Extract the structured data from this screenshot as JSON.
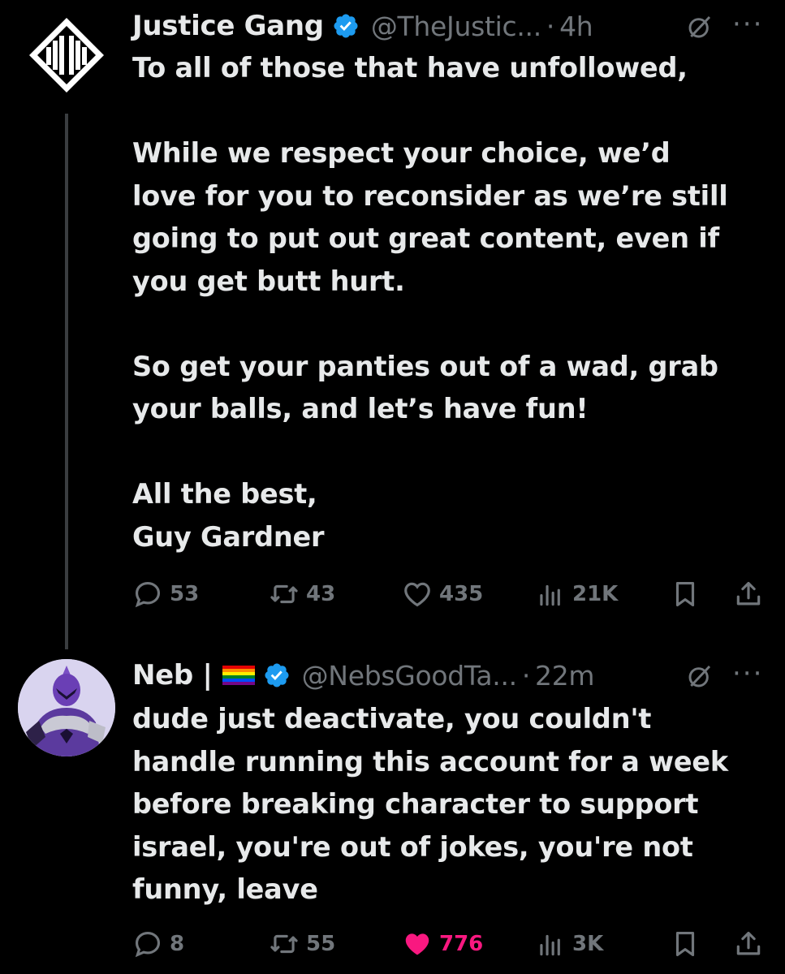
{
  "tweets": [
    {
      "name": "Justice Gang",
      "handle": "@TheJustic...",
      "separator": "·",
      "time": "4h",
      "text": "To all of those that have unfollowed,\n\nWhile we respect your choice, we’d\nlove for you to reconsider as we’re still\ngoing to put out great content, even if\nyou get butt hurt.\n\nSo get your panties out of a wad, grab\nyour balls, and let’s have fun!\n\nAll the best,\nGuy Gardner",
      "stats": {
        "replies": "53",
        "reposts": "43",
        "likes": "435",
        "views": "21K"
      },
      "liked": false
    },
    {
      "name": "Neb |",
      "name_flag": "rainbow-flag",
      "handle": "@NebsGoodTa...",
      "separator": "·",
      "time": "22m",
      "text": "dude just deactivate, you couldn't\nhandle running this account for a week\nbefore breaking character to support\nisrael, you're out of jokes, you're not\nfunny, leave",
      "stats": {
        "replies": "8",
        "reposts": "55",
        "likes": "776",
        "views": "3K"
      },
      "liked": true
    }
  ],
  "ui": {
    "more_label": "···"
  },
  "colors": {
    "background": "#000000",
    "text": "#e7e9ea",
    "muted": "#71767b",
    "verified": "#1d9bf0",
    "like_active": "#f91880",
    "thread_line": "#3a3d40"
  }
}
